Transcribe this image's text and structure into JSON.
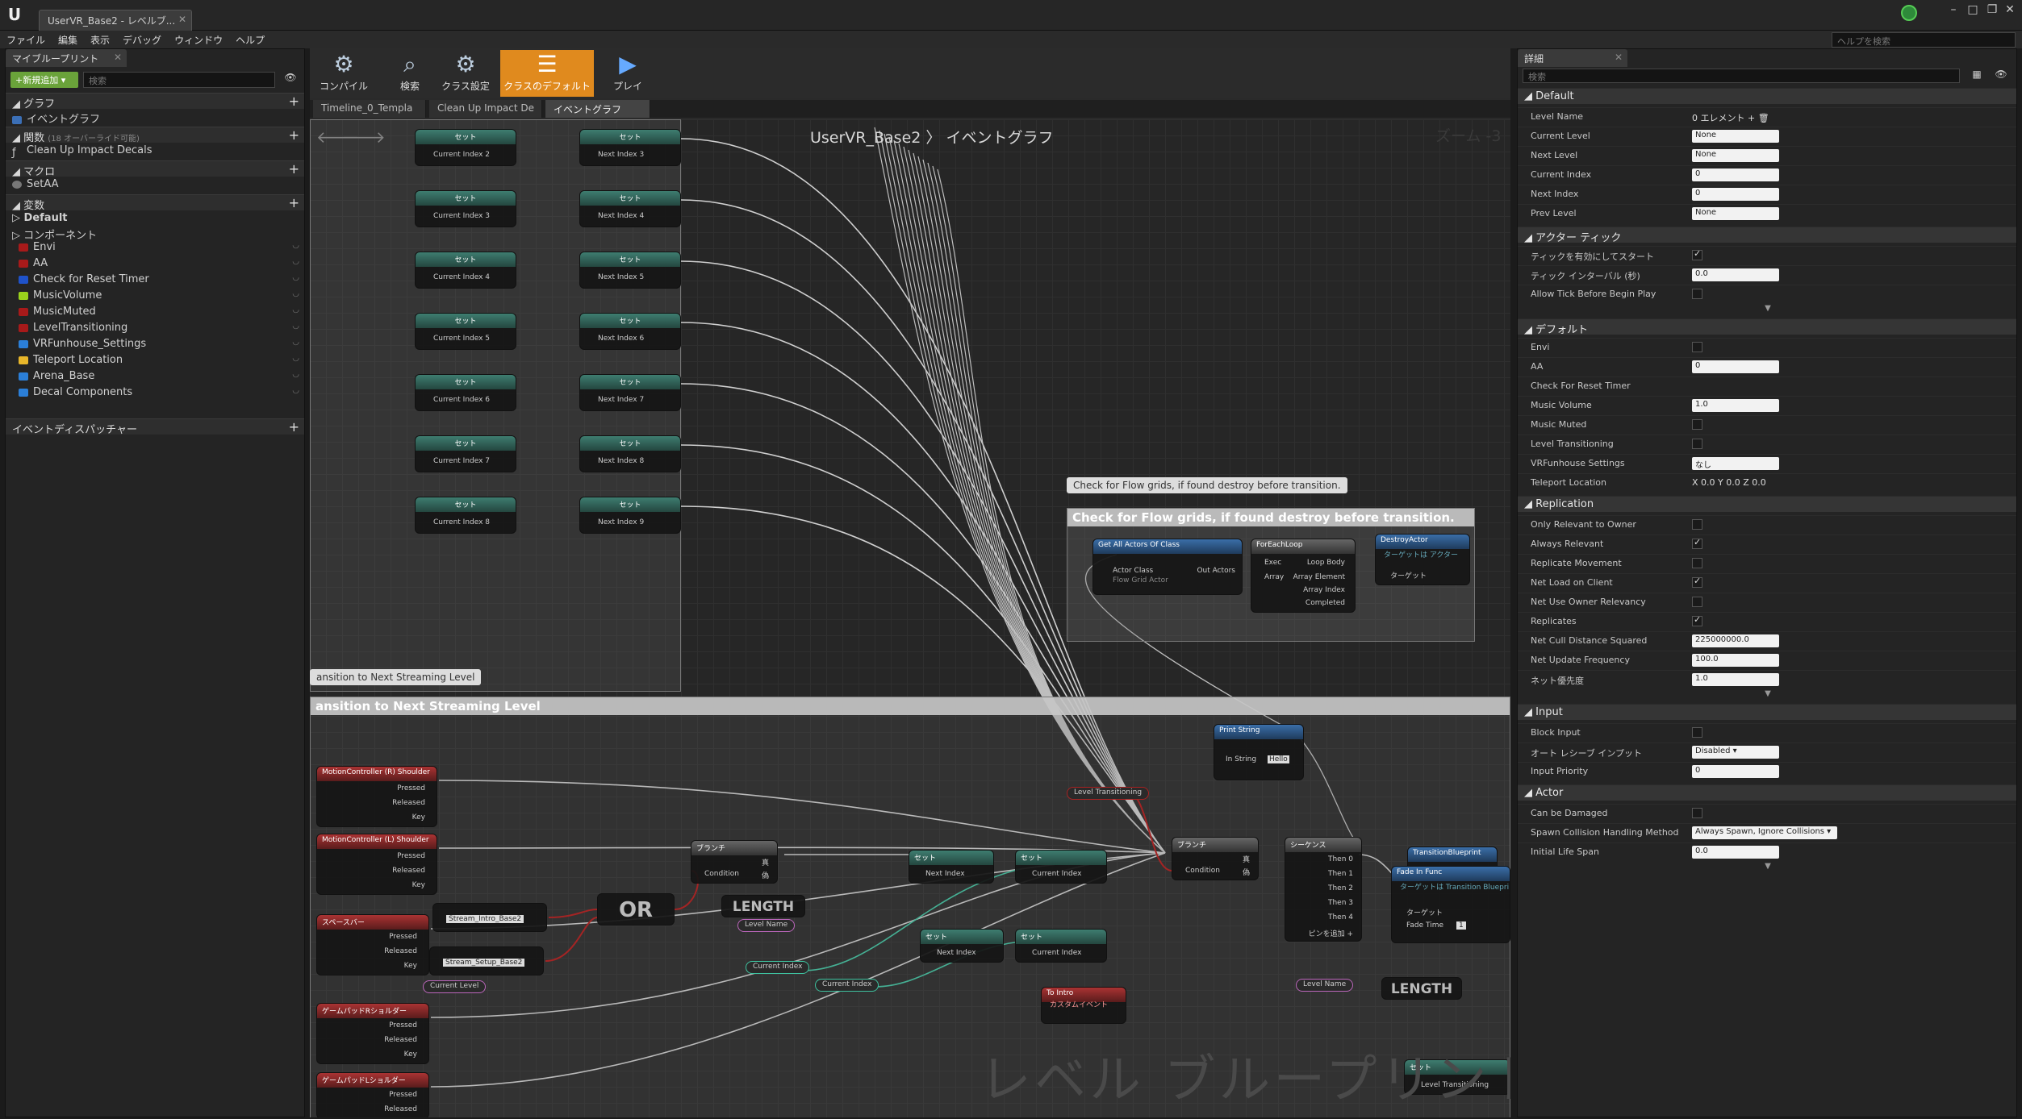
{
  "window": {
    "tab_title": "UserVR_Base2 - レベルブ...",
    "close": "✕",
    "min": "–",
    "max": "□",
    "restore": "❐"
  },
  "menu": [
    "ファイル",
    "編集",
    "表示",
    "デバッグ",
    "ウィンドウ",
    "ヘルプ"
  ],
  "help_search_placeholder": "ヘルプを検索",
  "left": {
    "tab": "マイブループリント",
    "add_new": "+新規追加 ▾",
    "search_placeholder": "検索",
    "sections": {
      "graph": "グラフ",
      "functions": "関数",
      "functions_note": "(18 オーバーライド可能)",
      "macros": "マクロ",
      "variables": "変数",
      "dispatchers": "イベントディスパッチャー"
    },
    "graph_items": [
      "イベントグラフ"
    ],
    "function_items": [
      "Clean Up Impact Decals"
    ],
    "macro_items": [
      "SetAA"
    ],
    "var_groups": [
      "Default",
      "コンポーネント"
    ],
    "variables": [
      {
        "name": "Envi",
        "color": "#a81a1a"
      },
      {
        "name": "AA",
        "color": "#a81a1a"
      },
      {
        "name": "Check for Reset Timer",
        "color": "#1f52c9"
      },
      {
        "name": "MusicVolume",
        "color": "#9ad21c"
      },
      {
        "name": "MusicMuted",
        "color": "#a81a1a"
      },
      {
        "name": "LevelTransitioning",
        "color": "#a81a1a"
      },
      {
        "name": "VRFunhouse_Settings",
        "color": "#2b7fd8"
      },
      {
        "name": "Teleport Location",
        "color": "#e8b62a"
      },
      {
        "name": "Arena_Base",
        "color": "#2b7fd8"
      },
      {
        "name": "Decal Components",
        "color": "#2b7fd8"
      }
    ]
  },
  "toolbar": [
    {
      "label": "コンパイル",
      "icon": "⚙"
    },
    {
      "label": "検索",
      "icon": "🔍"
    },
    {
      "label": "クラス設定",
      "icon": "⚙"
    },
    {
      "label": "クラスのデフォルト",
      "icon": "☑"
    },
    {
      "label": "プレイ",
      "icon": "▶"
    }
  ],
  "graph_tabs": [
    "Timeline_0_Templa",
    "Clean Up Impact De",
    "イベントグラフ"
  ],
  "graph": {
    "breadcrumb": "UserVR_Base2 〉 イベントグラフ",
    "zoom": "ズーム -3",
    "watermark": "レベル ブループリント",
    "comment1_title": "Check for Flow grids, if found destroy before transition.",
    "comment1_bubble": "Check for Flow grids, if found destroy before transition.",
    "comment2_title": "ansition to Next Streaming Level",
    "comment2_bubble": "ansition to Next Streaming Level",
    "set_label": "セット",
    "set_rows": [
      {
        "a": "Current Index 2",
        "b": "Next Index 3"
      },
      {
        "a": "Current Index 3",
        "b": "Next Index 4"
      },
      {
        "a": "Current Index 4",
        "b": "Next Index 5"
      },
      {
        "a": "Current Index 5",
        "b": "Next Index 6"
      },
      {
        "a": "Current Index 6",
        "b": "Next Index 7"
      },
      {
        "a": "Current Index 7",
        "b": "Next Index 8"
      },
      {
        "a": "Current Index 8",
        "b": "Next Index 9"
      }
    ],
    "get_all_actors": {
      "title": "Get All Actors Of Class",
      "actor_class": "Actor Class",
      "flow": "Flow Grid Actor",
      "out": "Out Actors"
    },
    "foreach": {
      "title": "ForEachLoop",
      "exec": "Exec",
      "array": "Array",
      "loop_body": "Loop Body",
      "element": "Array Element",
      "index": "Array Index",
      "completed": "Completed"
    },
    "destroy": {
      "title": "DestroyActor",
      "sub": "ターゲットは アクター",
      "target": "ターゲット"
    },
    "events": [
      {
        "title": "MotionController (R) Shoulder",
        "pins": [
          "Pressed",
          "Released",
          "Key"
        ]
      },
      {
        "title": "MotionController (L) Shoulder",
        "pins": [
          "Pressed",
          "Released",
          "Key"
        ]
      },
      {
        "title": "スペースバー",
        "pins": [
          "Pressed",
          "Released",
          "Key"
        ]
      },
      {
        "title": "ゲームパッドRショルダー",
        "pins": [
          "Pressed",
          "Released",
          "Key"
        ]
      },
      {
        "title": "ゲームパッドLショルダー",
        "pins": [
          "Pressed",
          "Released"
        ]
      }
    ],
    "print_string": {
      "title": "Print String",
      "in": "In String",
      "val": "Hello"
    },
    "level_transitioning": "Level Transitioning",
    "branch": "ブランチ",
    "condition": "Condition",
    "true": "真",
    "false": "偽",
    "sequence": "シーケンス",
    "then": [
      "Then 0",
      "Then 1",
      "Then 2",
      "Then 3",
      "Then 4"
    ],
    "add_pin": "ピンを追加 +",
    "stream1": "Stream_Intro_Base2",
    "stream2": "Stream_Setup_Base2",
    "current_level": "Current Level",
    "or": "OR",
    "length": "LENGTH",
    "level_name": "Level Name",
    "current_index": "Current Index",
    "next_index": "Next Index",
    "to_intro": "To Intro",
    "custom_event": "カスタムイベント",
    "fade": {
      "title": "Fade In Func",
      "sub": "ターゲットは Transition Bluepri",
      "target": "ターゲット",
      "time": "Fade Time",
      "time_val": "1"
    },
    "transition_bp": "TransitionBlueprint",
    "set_level_transitioning": "Level Transitioning"
  },
  "right": {
    "tab": "詳細",
    "search_placeholder": "検索",
    "sections": [
      {
        "title": "Default",
        "props": [
          {
            "label": "Level Name",
            "type": "txt",
            "value": "0 エレメント  +  🗑"
          },
          {
            "label": "Current Level",
            "type": "val",
            "value": "None"
          },
          {
            "label": "Next Level",
            "type": "val",
            "value": "None"
          },
          {
            "label": "Current Index",
            "type": "val",
            "value": "0"
          },
          {
            "label": "Next Index",
            "type": "val",
            "value": "0"
          },
          {
            "label": "Prev Level",
            "type": "val",
            "value": "None"
          }
        ]
      },
      {
        "title": "アクター ティック",
        "props": [
          {
            "label": "ティックを有効にしてスタート",
            "type": "cb",
            "value": true
          },
          {
            "label": "ティック インターバル (秒)",
            "type": "val",
            "value": "0.0"
          },
          {
            "label": "Allow Tick Before Begin Play",
            "type": "cb",
            "value": false
          }
        ]
      },
      {
        "title": "デフォルト",
        "props": [
          {
            "label": "Envi",
            "type": "cb",
            "value": false
          },
          {
            "label": "AA",
            "type": "val",
            "value": "0"
          },
          {
            "label": "Check For Reset Timer",
            "type": "txt",
            "value": ""
          },
          {
            "label": "Music Volume",
            "type": "val",
            "value": "1.0"
          },
          {
            "label": "Music Muted",
            "type": "cb",
            "value": false
          },
          {
            "label": "Level Transitioning",
            "type": "cb",
            "value": false
          },
          {
            "label": "VRFunhouse Settings",
            "type": "val",
            "value": "なし"
          },
          {
            "label": "Teleport Location",
            "type": "txt",
            "value": "X 0.0      Y 0.0      Z 0.0"
          }
        ]
      },
      {
        "title": "Replication",
        "props": [
          {
            "label": "Only Relevant to Owner",
            "type": "cb",
            "value": false
          },
          {
            "label": "Always Relevant",
            "type": "cb",
            "value": true
          },
          {
            "label": "Replicate Movement",
            "type": "cb",
            "value": false
          },
          {
            "label": "Net Load on Client",
            "type": "cb",
            "value": true
          },
          {
            "label": "Net Use Owner Relevancy",
            "type": "cb",
            "value": false
          },
          {
            "label": "Replicates",
            "type": "cb",
            "value": true
          },
          {
            "label": "Net Cull Distance Squared",
            "type": "val",
            "value": "225000000.0"
          },
          {
            "label": "Net Update Frequency",
            "type": "val",
            "value": "100.0"
          },
          {
            "label": "ネット優先度",
            "type": "val",
            "value": "1.0"
          }
        ]
      },
      {
        "title": "Input",
        "props": [
          {
            "label": "Block Input",
            "type": "cb",
            "value": false
          },
          {
            "label": "オート レシーブ インプット",
            "type": "val",
            "value": "Disabled ▾"
          },
          {
            "label": "Input Priority",
            "type": "val",
            "value": "0"
          }
        ]
      },
      {
        "title": "Actor",
        "props": [
          {
            "label": "Can be Damaged",
            "type": "cb",
            "value": false
          },
          {
            "label": "Spawn Collision Handling Method",
            "type": "val",
            "value": "Always Spawn, Ignore Collisions ▾"
          },
          {
            "label": "Initial Life Span",
            "type": "val",
            "value": "0.0"
          }
        ]
      }
    ]
  }
}
